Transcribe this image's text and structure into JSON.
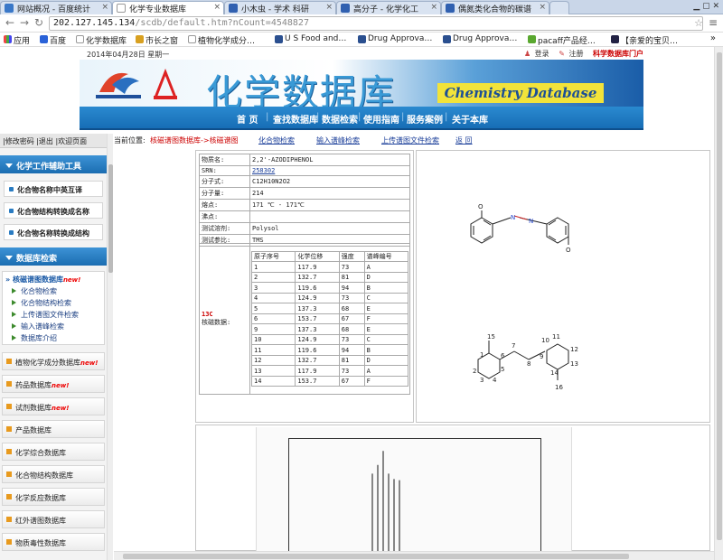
{
  "browser": {
    "tabs": [
      {
        "title": "网站概况 - 百度统计"
      },
      {
        "title": "化学专业数据库"
      },
      {
        "title": "小木虫 - 学术 科研"
      },
      {
        "title": "高分子 - 化学化工"
      },
      {
        "title": "偶氮类化合物的碳谱"
      }
    ],
    "url_host": "202.127.145.134",
    "url_path": "/scdb/default.htm?nCount=4548827",
    "bookmarks": [
      {
        "label": "应用"
      },
      {
        "label": "百度"
      },
      {
        "label": "化学数据库"
      },
      {
        "label": "市长之窗"
      },
      {
        "label": "植物化学成分…"
      },
      {
        "label": "U S Food and…"
      },
      {
        "label": "Drug Approva…"
      },
      {
        "label": "Drug Approva…"
      },
      {
        "label": "pacaff产品经…"
      },
      {
        "label": "【亲爱的宝贝…"
      }
    ],
    "bookmarks_more": "»"
  },
  "header": {
    "date": "2014年04月28日 星期一",
    "login": "登录",
    "register": "注册",
    "portal": "科学数据库门户",
    "title": "化学数据库",
    "title_en": "Chemistry Database",
    "nav": [
      "首 页",
      "查找数据库",
      "数据检索",
      "使用指南",
      "服务案例",
      "关于本库"
    ]
  },
  "sidebar": {
    "account_links": "|修改密码 |退出 |欢迎页面",
    "tools_header": "化学工作辅助工具",
    "tools": [
      "化合物名称中英互译",
      "化合物结构转换成名称",
      "化合物名称转换成结构"
    ],
    "search_header": "数据库检索",
    "active_db": {
      "label": "核磁谱图数据库",
      "badge": "new!"
    },
    "sub_links": [
      "化合物检索",
      "化合物结构检索",
      "上传谱图文件检索",
      "输入谱峰检索",
      "数据库介绍"
    ],
    "databases": [
      {
        "label": "植物化学成分数据库",
        "badge": "new!"
      },
      {
        "label": "药品数据库",
        "badge": "new!"
      },
      {
        "label": "试剂数据库",
        "badge": "new!"
      },
      {
        "label": "产品数据库",
        "badge": ""
      },
      {
        "label": "化学综合数据库",
        "badge": ""
      },
      {
        "label": "化合物结构数据库",
        "badge": ""
      },
      {
        "label": "化学反应数据库",
        "badge": ""
      },
      {
        "label": "红外谱图数据库",
        "badge": ""
      },
      {
        "label": "物质毒性数据库",
        "badge": ""
      }
    ]
  },
  "breadcrumb": {
    "label": "当前位置:",
    "path": "核磁谱图数据库->核磁谱图",
    "links": [
      "化合物检索",
      "输入谱峰检索",
      "上传谱图文件检索",
      "返 回"
    ]
  },
  "compound": {
    "rows": [
      {
        "key": "物质名:",
        "value": "2,2'-AZODIPHENOL"
      },
      {
        "key": "SRN:",
        "value": "258302"
      },
      {
        "key": "分子式:",
        "value": "C12H10N2O2"
      },
      {
        "key": "分子量:",
        "value": "214"
      },
      {
        "key": "熔点:",
        "value": "171 ℃ - 171℃"
      },
      {
        "key": "沸点:",
        "value": ""
      },
      {
        "key": "测试溶剂:",
        "value": "Polysol"
      },
      {
        "key": "测试参比:",
        "value": "TMS"
      }
    ],
    "nmr_type": "13C",
    "nmr_label": "核磁数据:",
    "peak_headers": [
      "原子序号",
      "化学位移",
      "强度",
      "谱峰编号"
    ],
    "peaks": [
      [
        "1",
        "117.9",
        "73",
        "A"
      ],
      [
        "2",
        "132.7",
        "81",
        "D"
      ],
      [
        "3",
        "119.6",
        "94",
        "B"
      ],
      [
        "4",
        "124.9",
        "73",
        "C"
      ],
      [
        "5",
        "137.3",
        "68",
        "E"
      ],
      [
        "6",
        "153.7",
        "67",
        "F"
      ],
      [
        "9",
        "137.3",
        "68",
        "E"
      ],
      [
        "10",
        "124.9",
        "73",
        "C"
      ],
      [
        "11",
        "119.6",
        "94",
        "B"
      ],
      [
        "12",
        "132.7",
        "81",
        "D"
      ],
      [
        "13",
        "117.9",
        "73",
        "A"
      ],
      [
        "14",
        "153.7",
        "67",
        "F"
      ]
    ]
  },
  "structure_labels": {
    "top": [
      "O",
      "N",
      "N",
      "O"
    ],
    "numbered": [
      "15",
      "1",
      "6",
      "5",
      "2",
      "3",
      "4",
      "7",
      "8",
      "9",
      "10",
      "11",
      "14",
      "13",
      "12",
      "16"
    ]
  },
  "spectrum": {
    "peak_intensities": [
      73,
      81,
      94,
      73,
      68,
      67
    ]
  },
  "colors": {
    "accent": "#1b6db1",
    "nav": "#176db5",
    "new_badge": "#e00000"
  }
}
